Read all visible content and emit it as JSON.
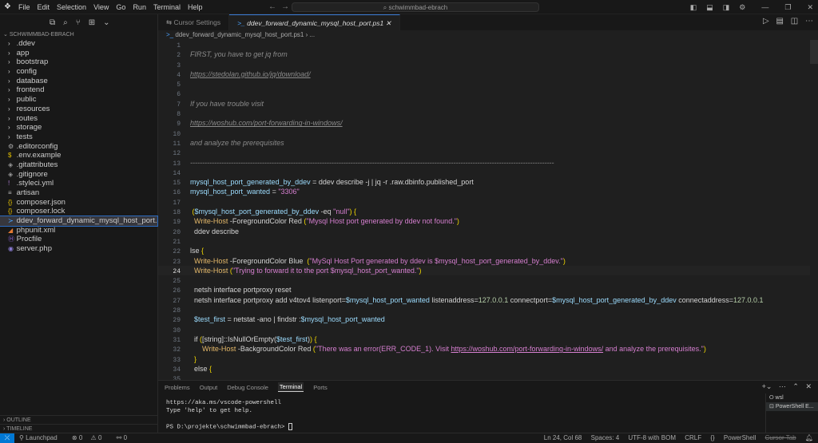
{
  "titlebar": {
    "menu": [
      "File",
      "Edit",
      "Selection",
      "View",
      "Go",
      "Run",
      "Terminal",
      "Help"
    ],
    "search": "schwimmbad-ebrach"
  },
  "sidebar": {
    "project": "SCHWIMMBAD-EBRACH",
    "items": [
      {
        "label": ".ddev",
        "icon": "chevron-right",
        "type": "folder"
      },
      {
        "label": "app",
        "icon": "chevron-right",
        "type": "folder"
      },
      {
        "label": "bootstrap",
        "icon": "chevron-right",
        "type": "folder"
      },
      {
        "label": "config",
        "icon": "chevron-right",
        "type": "folder"
      },
      {
        "label": "database",
        "icon": "chevron-right",
        "type": "folder"
      },
      {
        "label": "frontend",
        "icon": "chevron-right",
        "type": "folder"
      },
      {
        "label": "public",
        "icon": "chevron-right",
        "type": "folder"
      },
      {
        "label": "resources",
        "icon": "chevron-right",
        "type": "folder"
      },
      {
        "label": "routes",
        "icon": "chevron-right",
        "type": "folder"
      },
      {
        "label": "storage",
        "icon": "chevron-right",
        "type": "folder"
      },
      {
        "label": "tests",
        "icon": "chevron-right",
        "type": "folder"
      },
      {
        "label": ".editorconfig",
        "icon": "gear",
        "type": "file"
      },
      {
        "label": ".env.example",
        "icon": "dollar",
        "type": "file"
      },
      {
        "label": ".gitattributes",
        "icon": "git",
        "type": "file"
      },
      {
        "label": ".gitignore",
        "icon": "git",
        "type": "file"
      },
      {
        "label": ".styleci.yml",
        "icon": "exclamation",
        "type": "file"
      },
      {
        "label": "artisan",
        "icon": "lines",
        "type": "file"
      },
      {
        "label": "composer.json",
        "icon": "braces",
        "type": "file"
      },
      {
        "label": "composer.lock",
        "icon": "braces",
        "type": "file"
      },
      {
        "label": "ddev_forward_dynamic_mysql_host_port.ps1",
        "icon": "powershell",
        "type": "file",
        "active": true
      },
      {
        "label": "phpunit.xml",
        "icon": "rss",
        "type": "file"
      },
      {
        "label": "Procfile",
        "icon": "heroku",
        "type": "file"
      },
      {
        "label": "server.php",
        "icon": "elephant",
        "type": "file"
      }
    ],
    "outline": "OUTLINE",
    "timeline": "TIMELINE"
  },
  "tabs": [
    {
      "label": "Cursor Settings"
    },
    {
      "label": "ddev_forward_dynamic_mysql_host_port.ps1",
      "active": true
    }
  ],
  "breadcrumb": {
    "file": "ddev_forward_dynamic_mysql_host_port.ps1",
    "more": "..."
  },
  "editor": {
    "current_line": 24,
    "lines": [
      [],
      [
        [
          "FIRST, you have to get jq from",
          "c"
        ]
      ],
      [],
      [
        [
          "https://stedolan.github.io/jq/download/",
          "u"
        ]
      ],
      [],
      [],
      [
        [
          "If you have trouble visit",
          "c"
        ]
      ],
      [],
      [
        [
          "https://woshub.com/port-forwarding-in-windows/",
          "u"
        ]
      ],
      [],
      [
        [
          "and analyze the prerequisites",
          "c"
        ]
      ],
      [],
      [
        [
          "--------------------------------------------------------------------------------------------------------------------------------------------------------",
          "c"
        ]
      ],
      [],
      [
        [
          "mysql_host_port_generated_by_ddev",
          "v"
        ],
        [
          " = ddev describe -j | jq -r .raw.dbinfo.published_port",
          "p"
        ]
      ],
      [
        [
          "mysql_host_port_wanted",
          "v"
        ],
        [
          " = ",
          "p"
        ],
        [
          "\"3306\"",
          "s"
        ]
      ],
      [],
      [
        [
          " (",
          "b"
        ],
        [
          "$mysql_host_port_generated_by_ddev",
          "v"
        ],
        [
          " -eq ",
          "p"
        ],
        [
          "\"null\"",
          "s"
        ],
        [
          ") {",
          "b"
        ]
      ],
      [
        [
          "  Write-Host",
          "f"
        ],
        [
          " -ForegroundColor Red ",
          "p"
        ],
        [
          "(",
          "b"
        ],
        [
          "\"Mysql Host port generated by ddev not found.\"",
          "s"
        ],
        [
          ")",
          "b"
        ]
      ],
      [
        [
          "  ddev describe",
          "p"
        ]
      ],
      [],
      [
        [
          "lse ",
          "p"
        ],
        [
          "{",
          "b"
        ]
      ],
      [
        [
          "  Write-Host",
          "f"
        ],
        [
          " -ForegroundColor Blue  ",
          "p"
        ],
        [
          "(",
          "b"
        ],
        [
          "\"MySql Host Port generated by ddev is $mysql_host_port_generated_by_ddev.\"",
          "s"
        ],
        [
          ")",
          "b"
        ]
      ],
      [
        [
          "  Write-Host",
          "f"
        ],
        [
          " ",
          "p"
        ],
        [
          "(",
          "b"
        ],
        [
          "\"Trying to forward it to the port $mysql_host_port_wanted.\"",
          "s"
        ],
        [
          ")",
          "b"
        ]
      ],
      [],
      [
        [
          "  netsh interface portproxy reset",
          "p"
        ]
      ],
      [
        [
          "  netsh interface portproxy add v4tov4 listenport=",
          "p"
        ],
        [
          "$mysql_host_port_wanted",
          "v"
        ],
        [
          " listenaddress=",
          "p"
        ],
        [
          "127.0.0.1",
          "n"
        ],
        [
          " connectport=",
          "p"
        ],
        [
          "$mysql_host_port_generated_by_ddev",
          "v"
        ],
        [
          " connectaddress=",
          "p"
        ],
        [
          "127.0.0.1",
          "n"
        ]
      ],
      [],
      [
        [
          "  $test_first",
          "v"
        ],
        [
          " = netstat -ano | findstr :",
          "p"
        ],
        [
          "$mysql_host_port_wanted",
          "v"
        ]
      ],
      [],
      [
        [
          "  if ",
          "p"
        ],
        [
          "(",
          "b"
        ],
        [
          "[string]::IsNullOrEmpty(",
          "p"
        ],
        [
          "$test_first",
          "v"
        ],
        [
          ")",
          "p"
        ],
        [
          ") {",
          "b"
        ]
      ],
      [
        [
          "      Write-Host",
          "f"
        ],
        [
          " -BackgroundColor Red ",
          "p"
        ],
        [
          "(",
          "b"
        ],
        [
          "\"There was an error(ERR_CODE_1). Visit ",
          "s"
        ],
        [
          "https://woshub.com/port-forwarding-in-windows/",
          "su"
        ],
        [
          " and analyze the prerequisites.\"",
          "s"
        ],
        [
          ")",
          "b"
        ]
      ],
      [
        [
          "  }",
          "b"
        ]
      ],
      [
        [
          "  else ",
          "p"
        ],
        [
          "{",
          "b"
        ]
      ],
      []
    ]
  },
  "panel": {
    "tabs": [
      "Problems",
      "Output",
      "Debug Console",
      "Terminal",
      "Ports"
    ],
    "active_tab": "Terminal",
    "terminal_lines": [
      "https://aka.ms/vscode-powershell",
      "Type 'help' to get help.",
      ""
    ],
    "prompt": "PS D:\\projekte\\schwimmbad-ebrach> ",
    "terminals": [
      "wsl",
      "PowerShell E..."
    ]
  },
  "status": {
    "launchpad": "Launchpad",
    "errors": "0",
    "warnings": "0",
    "ports": "0",
    "position": "Ln 24, Col 68",
    "spaces": "Spaces: 4",
    "encoding": "UTF-8 with BOM",
    "eol": "CRLF",
    "language": "PowerShell",
    "cursor_tab": "Cursor Tab"
  }
}
